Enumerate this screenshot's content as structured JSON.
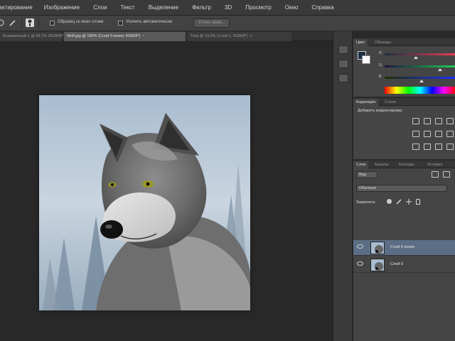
{
  "menu": {
    "items": [
      "дактирование",
      "Изображение",
      "Слои",
      "Текст",
      "Выделение",
      "Фильтр",
      "3D",
      "Просмотр",
      "Окно",
      "Справка"
    ]
  },
  "options_bar": {
    "sample_all_layers": "Образец со всех слоев",
    "auto_enhance": "Усилить автоматически",
    "refine_edge": "Уточн. край..."
  },
  "tabs": [
    {
      "label": "Безымянный-1 @ 66,7% (RGB/8)*",
      "active": false
    },
    {
      "label": "Wolf.jpg @ 100% (Слой 0 копия, RGB/8*)",
      "active": true
    },
    {
      "label": "Тигр @ 33,3% (Слой 1, RGB/8*)",
      "active": false
    }
  ],
  "color_panel": {
    "tabs": [
      "Цвет",
      "Образцы"
    ],
    "channels": [
      "R",
      "G",
      "B"
    ],
    "channel_values": [
      0.44,
      0.78,
      0.52
    ]
  },
  "adjustments_panel": {
    "tabs": [
      "Коррекция",
      "Стили"
    ],
    "title": "Добавить корректировку"
  },
  "layers_panel": {
    "tabs": [
      "Слои",
      "Каналы",
      "Контуры",
      "История"
    ],
    "kind_filter": "Вид",
    "blend_mode": "Обычные",
    "lock_label": "Закрепить:",
    "layers": [
      {
        "name": "Слой 0 копия",
        "selected": true
      },
      {
        "name": "Слой 0",
        "selected": false
      }
    ]
  },
  "colors": {
    "menubar": "#3a3a3a",
    "canvas_bg": "#282828",
    "selected_layer": "#5b6e85"
  }
}
